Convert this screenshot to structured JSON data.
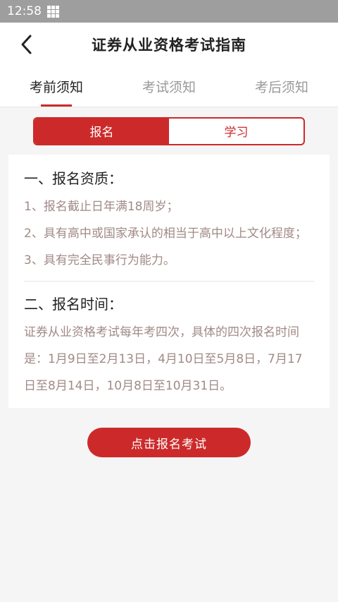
{
  "status": {
    "time": "12:58",
    "icon": "grid-icon"
  },
  "header": {
    "title": "证券从业资格考试指南",
    "back_icon": "chevron-left-icon"
  },
  "tabs": [
    {
      "label": "考前须知",
      "active": true
    },
    {
      "label": "考试须知",
      "active": false
    },
    {
      "label": "考后须知",
      "active": false
    }
  ],
  "segment": {
    "left": "报名",
    "right": "学习",
    "selected": "报名"
  },
  "content": {
    "section1": {
      "heading": "一、报名资质：",
      "items": [
        "1、报名截止日年满18周岁；",
        "2、具有高中或国家承认的相当于高中以上文化程度；",
        "3、具有完全民事行为能力。"
      ]
    },
    "section2": {
      "heading": "二、报名时间：",
      "text": "证券从业资格考试每年考四次，具体的四次报名时间是：1月9日至2月13日，4月10日至5月8日，7月17日至8月14日，10月8日至10月31日。"
    }
  },
  "cta": {
    "label": "点击报名考试"
  },
  "colors": {
    "accent": "#cc2a2a",
    "statusbar": "#9e9e9e"
  }
}
